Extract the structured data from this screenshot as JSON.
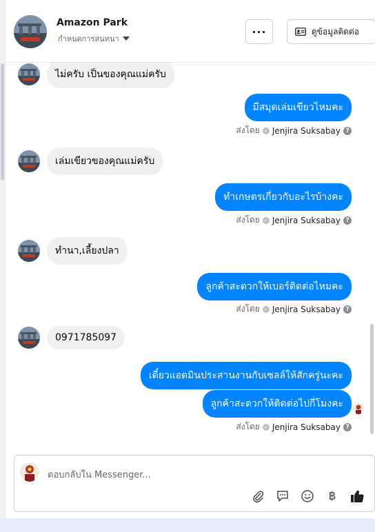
{
  "header": {
    "title": "Amazon Park",
    "subtitle": "กำหนดการสนทนา",
    "more_label": "···",
    "contact_label": "ดูข้อมูลติดต่อ"
  },
  "messages": [
    {
      "dir": "in",
      "text": "ไม่ครับ เป็นของคุณแม่ครับ"
    },
    {
      "dir": "out",
      "text": "มีสมุดเล่มเขียวไหมคะ"
    },
    {
      "dir": "in",
      "text": "เล่มเขียวของคุณแม่ครับ"
    },
    {
      "dir": "out",
      "text": "ทำเกษตรเกี่ยวกับอะไรบ้างคะ"
    },
    {
      "dir": "in",
      "text": "ทำนา,เลี้ยงปลา"
    },
    {
      "dir": "out",
      "text": "ลูกค้าสะดวกให้เบอร์ติดต่อไหมคะ"
    },
    {
      "dir": "in",
      "text": "0971785097"
    },
    {
      "dir": "out",
      "text": "เดี๋ยวแอดมินประสานงานกับเซลล์ให้สักครู่นะคะ"
    },
    {
      "dir": "out",
      "text": "ลูกค้าสะดวกให้ติดต่อไปกี่โมงคะ"
    }
  ],
  "sent_by": {
    "prefix": "ส่งโดย",
    "name": "Jenjira Suksabay"
  },
  "composer": {
    "placeholder": "ตอบกลับใน Messenger..."
  },
  "colors": {
    "accent": "#0084ff",
    "incoming_bubble": "#f0f0f0"
  },
  "icons": [
    "more-icon",
    "contact-card-icon",
    "attach-icon",
    "saved-reply-icon",
    "emoji-icon",
    "baht-icon",
    "like-icon"
  ]
}
